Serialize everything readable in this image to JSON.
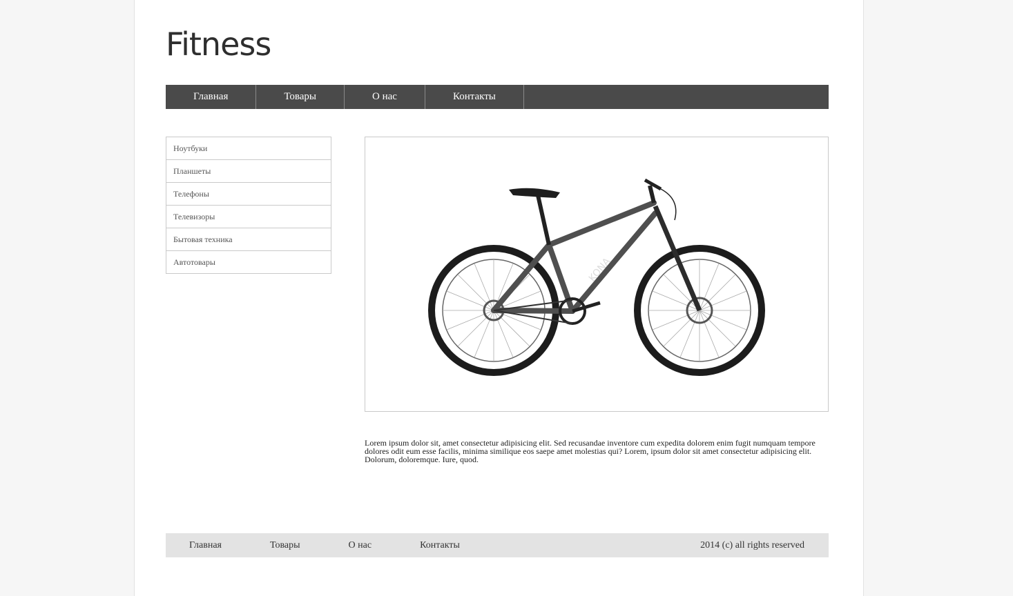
{
  "header": {
    "logo": "Fitness"
  },
  "nav": [
    {
      "label": "Главная"
    },
    {
      "label": "Товары"
    },
    {
      "label": "О нас"
    },
    {
      "label": "Контакты"
    }
  ],
  "sidebar": {
    "items": [
      {
        "label": "Ноутбуки"
      },
      {
        "label": "Планшеты"
      },
      {
        "label": "Телефоны"
      },
      {
        "label": "Телевизоры"
      },
      {
        "label": "Бытовая техника"
      },
      {
        "label": "Автотовары"
      }
    ]
  },
  "product": {
    "image": "bicycle",
    "description": "Lorem ipsum dolor sit, amet consectetur adipisicing elit. Sed recusandae inventore cum expedita dolorem enim fugit numquam tempore dolores odit eum esse facilis, minima similique eos saepe amet molestias qui? Lorem, ipsum dolor sit amet consectetur adipisicing elit. Dolorum, doloremque. Iure, quod."
  },
  "footer": {
    "links": [
      {
        "label": "Главная"
      },
      {
        "label": "Товары"
      },
      {
        "label": "О нас"
      },
      {
        "label": "Контакты"
      }
    ],
    "copyright": "2014 (c) all rights reserved"
  },
  "colors": {
    "nav_bg": "#4a4a4a",
    "footer_bg": "#e3e3e3",
    "page_bg": "#f6f6f6"
  }
}
